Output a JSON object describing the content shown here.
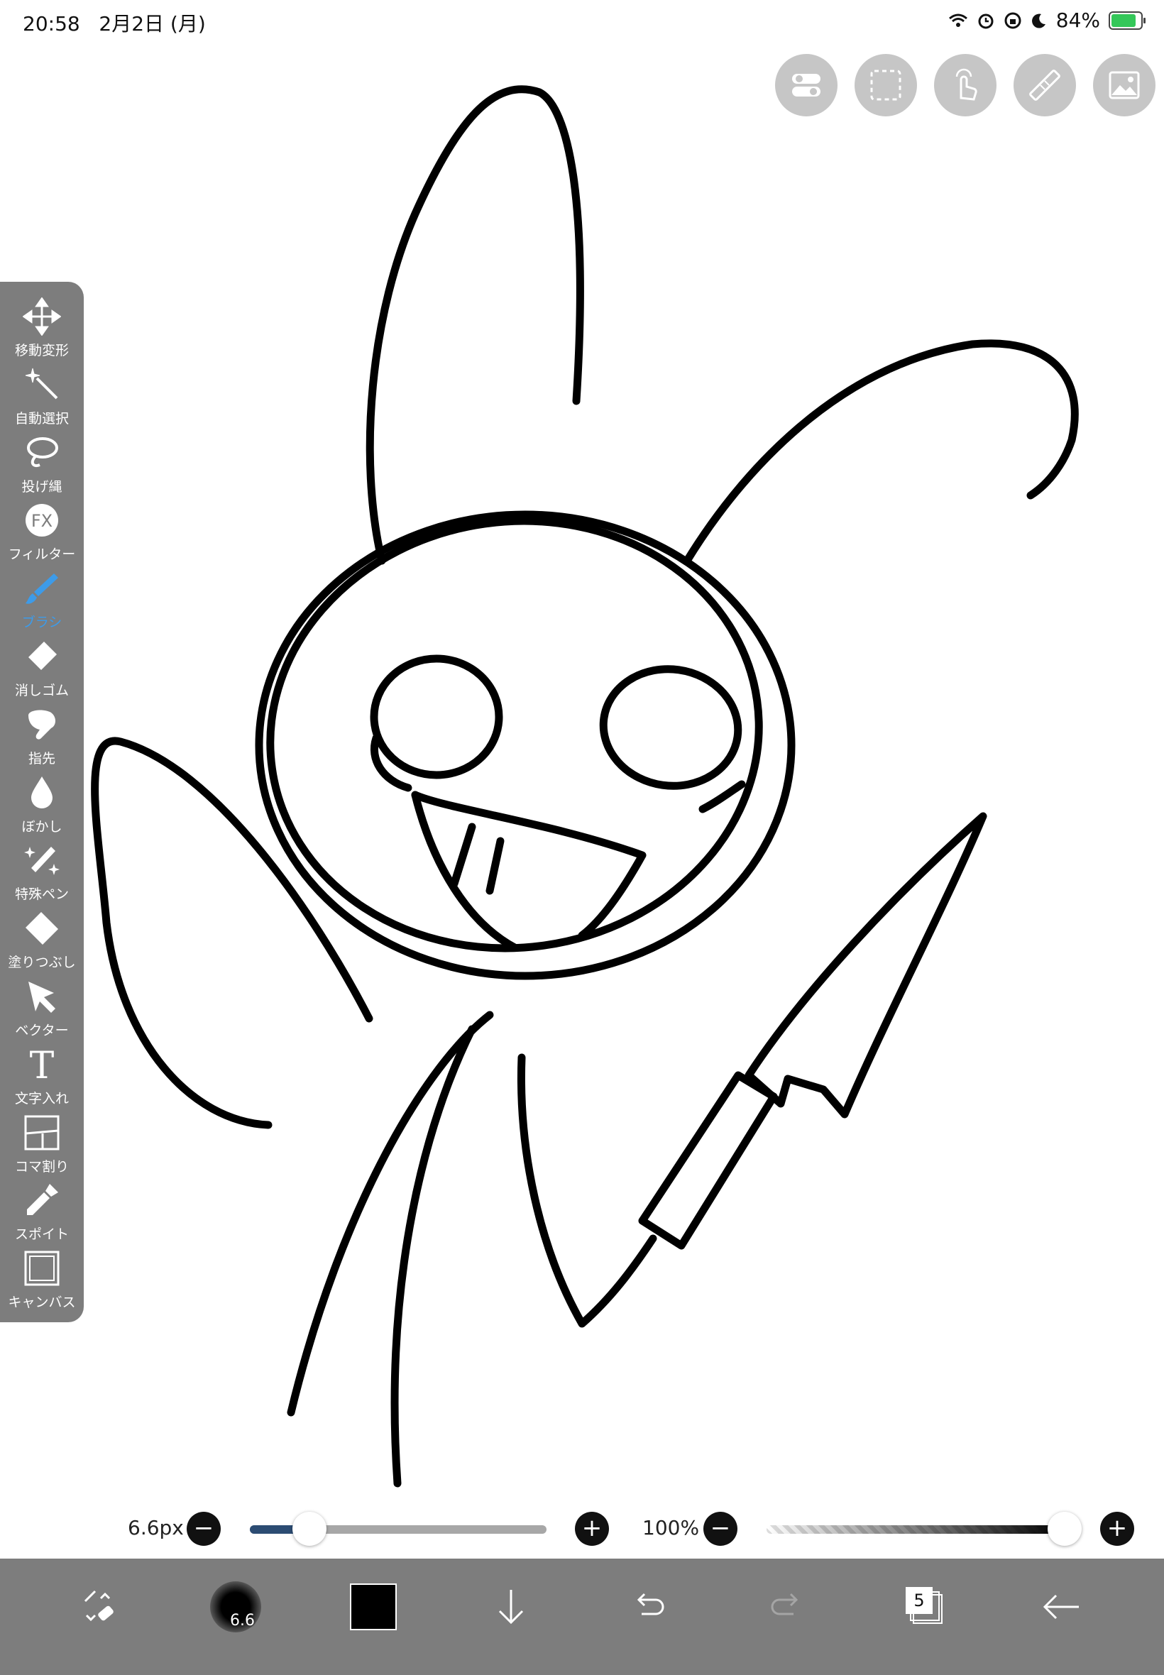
{
  "status_bar": {
    "time": "20:58",
    "date": "2月2日 (月)",
    "battery_percent": "84%",
    "battery_level": 0.84,
    "icons": [
      "wifi-icon",
      "alarm-icon",
      "rotation-lock-icon",
      "moon-icon",
      "battery-charging-icon"
    ]
  },
  "top_buttons": [
    {
      "name": "settings-toggle-button",
      "icon": "toggle-icon"
    },
    {
      "name": "selection-button",
      "icon": "dashed-rectangle-icon"
    },
    {
      "name": "gesture-button",
      "icon": "hand-touch-icon"
    },
    {
      "name": "ruler-button",
      "icon": "ruler-icon"
    },
    {
      "name": "material-button",
      "icon": "image-icon"
    }
  ],
  "toolbar": {
    "items": [
      {
        "label": "移動変形",
        "icon": "move-arrows-icon"
      },
      {
        "label": "自動選択",
        "icon": "magic-wand-icon"
      },
      {
        "label": "投げ縄",
        "icon": "lasso-icon"
      },
      {
        "label": "フィルター",
        "icon": "fx-icon",
        "icon_text": "FX"
      },
      {
        "label": "ブラシ",
        "icon": "brush-icon",
        "active": true
      },
      {
        "label": "消しゴム",
        "icon": "eraser-icon"
      },
      {
        "label": "指先",
        "icon": "finger-icon"
      },
      {
        "label": "ぼかし",
        "icon": "blur-drop-icon"
      },
      {
        "label": "特殊ペン",
        "icon": "special-pen-icon"
      },
      {
        "label": "塗りつぶし",
        "icon": "fill-bucket-icon"
      },
      {
        "label": "ベクター",
        "icon": "vector-cursor-icon"
      },
      {
        "label": "文字入れ",
        "icon": "text-icon",
        "icon_text": "T"
      },
      {
        "label": "コマ割り",
        "icon": "frame-divider-icon"
      },
      {
        "label": "スポイト",
        "icon": "eyedropper-icon"
      },
      {
        "label": "キャンバス",
        "icon": "canvas-icon"
      }
    ],
    "active_color": "#3d9be9"
  },
  "brush_controls": {
    "size_value": "6.6px",
    "size_fraction": 0.2,
    "opacity_value": "100%",
    "opacity_fraction": 1.0,
    "minus": "−",
    "plus": "+"
  },
  "bottom_bar": {
    "brush_preview_label": "6.6",
    "layer_count": "5",
    "current_color": "#000000",
    "icons": [
      "transform-swap-icon",
      "brush-preview-icon",
      "color-swatch-icon",
      "download-arrow-icon",
      "undo-icon",
      "redo-icon",
      "layers-icon",
      "back-arrow-icon"
    ]
  }
}
